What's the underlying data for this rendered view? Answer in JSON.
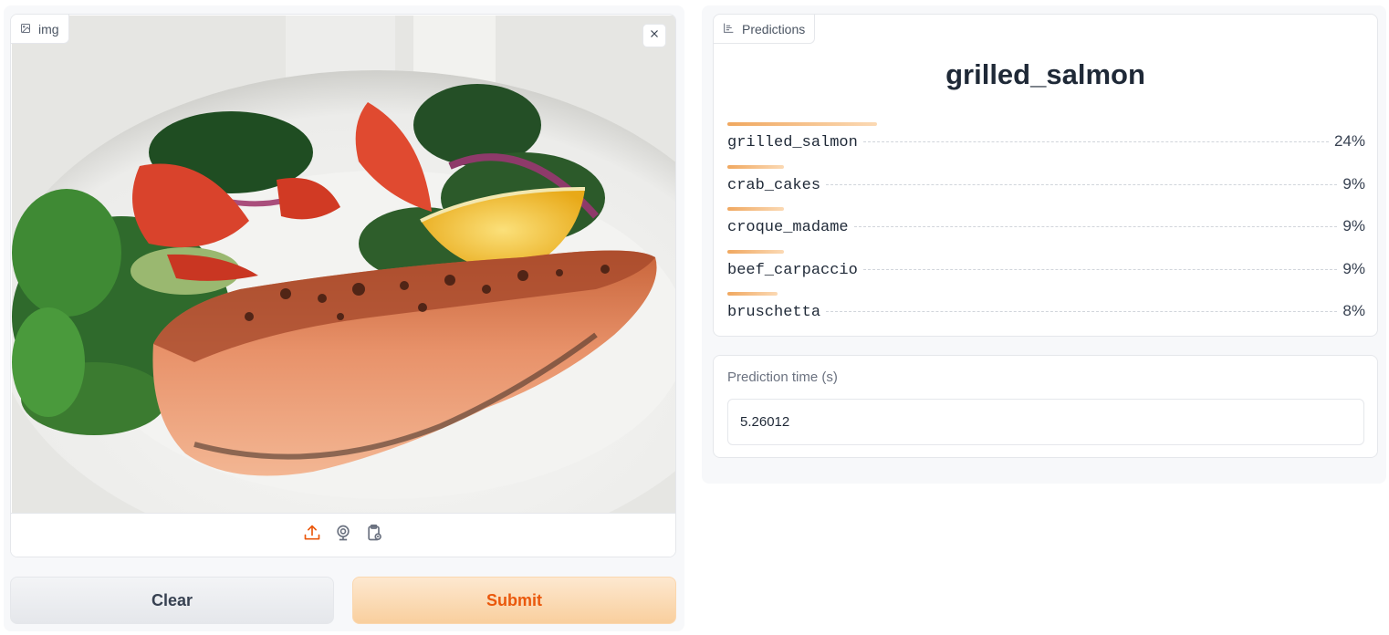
{
  "input": {
    "label": "img",
    "label_icon": "image-icon",
    "close_icon": "close-icon",
    "sources": [
      {
        "icon": "upload-icon",
        "color": "#ea580c"
      },
      {
        "icon": "webcam-icon",
        "color": "#6b7280"
      },
      {
        "icon": "clipboard-icon",
        "color": "#6b7280"
      }
    ],
    "photo_description_icon": "food-photo"
  },
  "buttons": {
    "clear_label": "Clear",
    "submit_label": "Submit"
  },
  "predictions": {
    "label": "Predictions",
    "label_icon": "bar-chart-icon",
    "top_label": "grilled_salmon",
    "items": [
      {
        "name": "grilled_salmon",
        "percent": "24%",
        "value": 0.24
      },
      {
        "name": "crab_cakes",
        "percent": "9%",
        "value": 0.09
      },
      {
        "name": "croque_madame",
        "percent": "9%",
        "value": 0.09
      },
      {
        "name": "beef_carpaccio",
        "percent": "9%",
        "value": 0.09
      },
      {
        "name": "bruschetta",
        "percent": "8%",
        "value": 0.08
      }
    ]
  },
  "prediction_time": {
    "label": "Prediction time (s)",
    "value": "5.26012"
  },
  "colors": {
    "accent": "#ea580c",
    "bar_start": "#f0a860",
    "bar_end": "#fbd9b4"
  }
}
